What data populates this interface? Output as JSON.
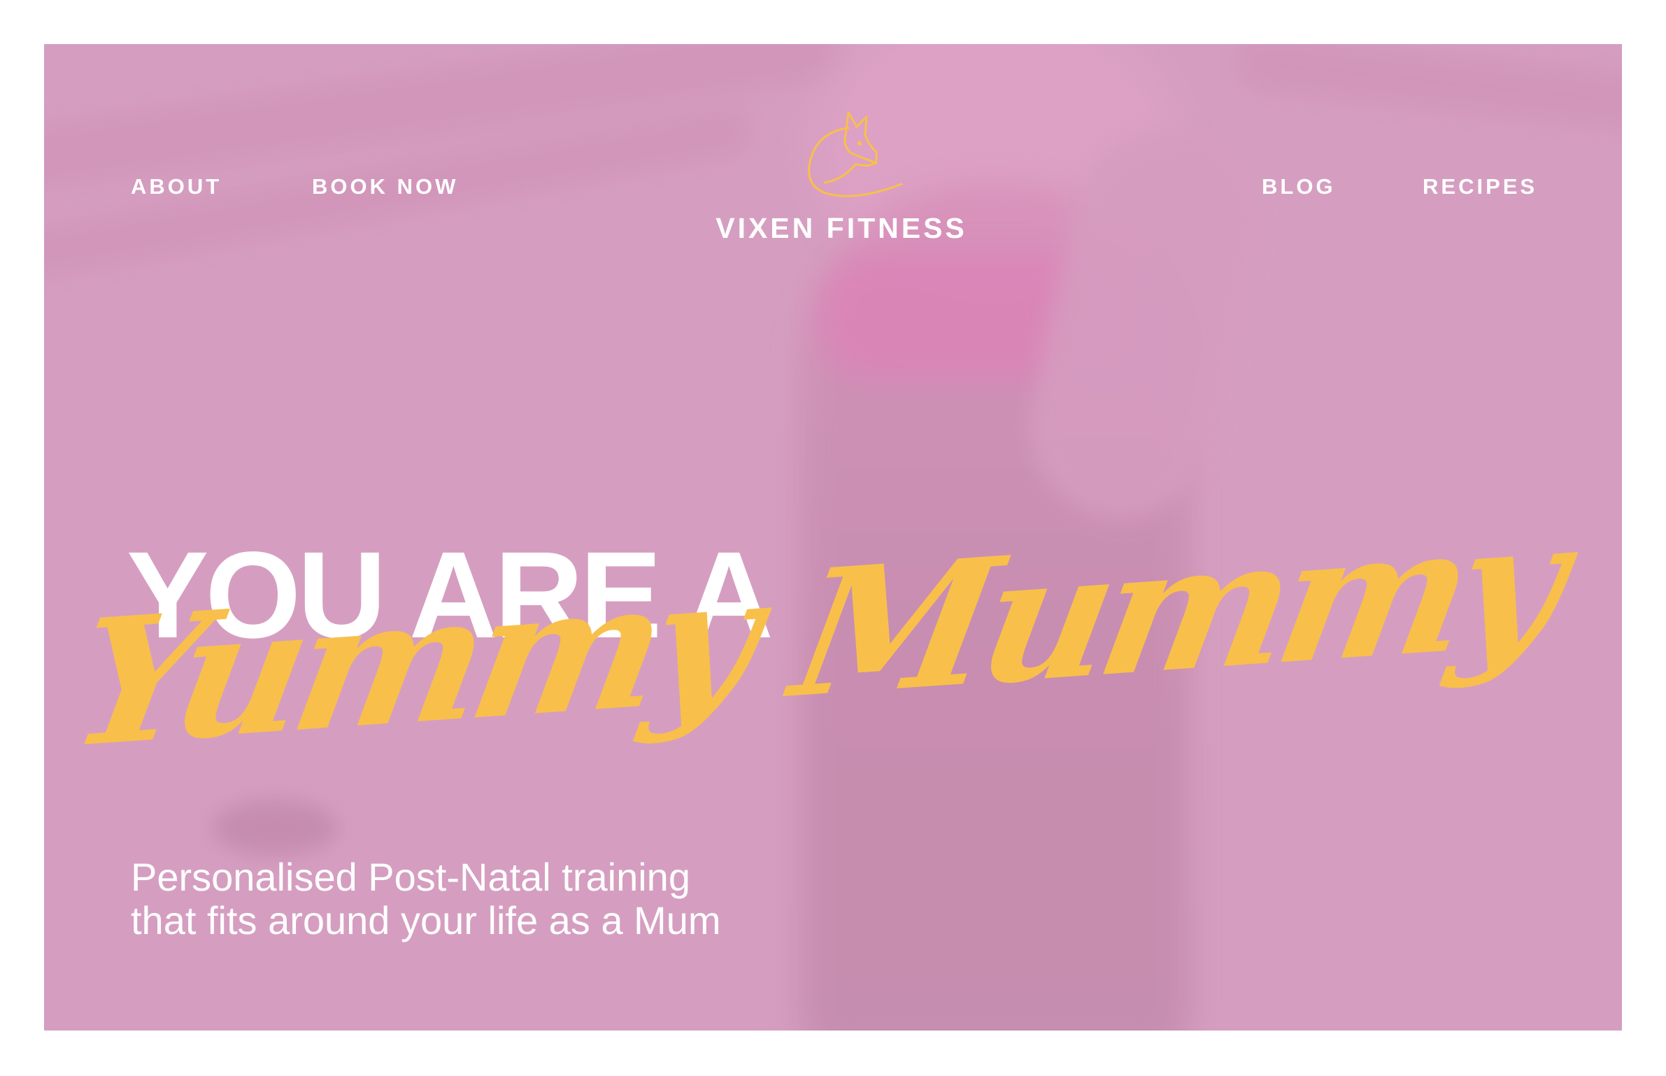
{
  "nav": {
    "about": "ABOUT",
    "book_now": "BOOK NOW",
    "blog": "BLOG",
    "recipes": "RECIPES"
  },
  "brand": {
    "name": "VIXEN FITNESS",
    "logo_icon": "fox-icon",
    "accent_color": "#f8c04a"
  },
  "hero": {
    "background_color": "#d59ec0",
    "headline": "YOU ARE A",
    "script_headline": "Yummy Mummy",
    "subtitle_line1": "Personalised Post-Natal training",
    "subtitle_line2": "that fits around your life as a Mum"
  }
}
